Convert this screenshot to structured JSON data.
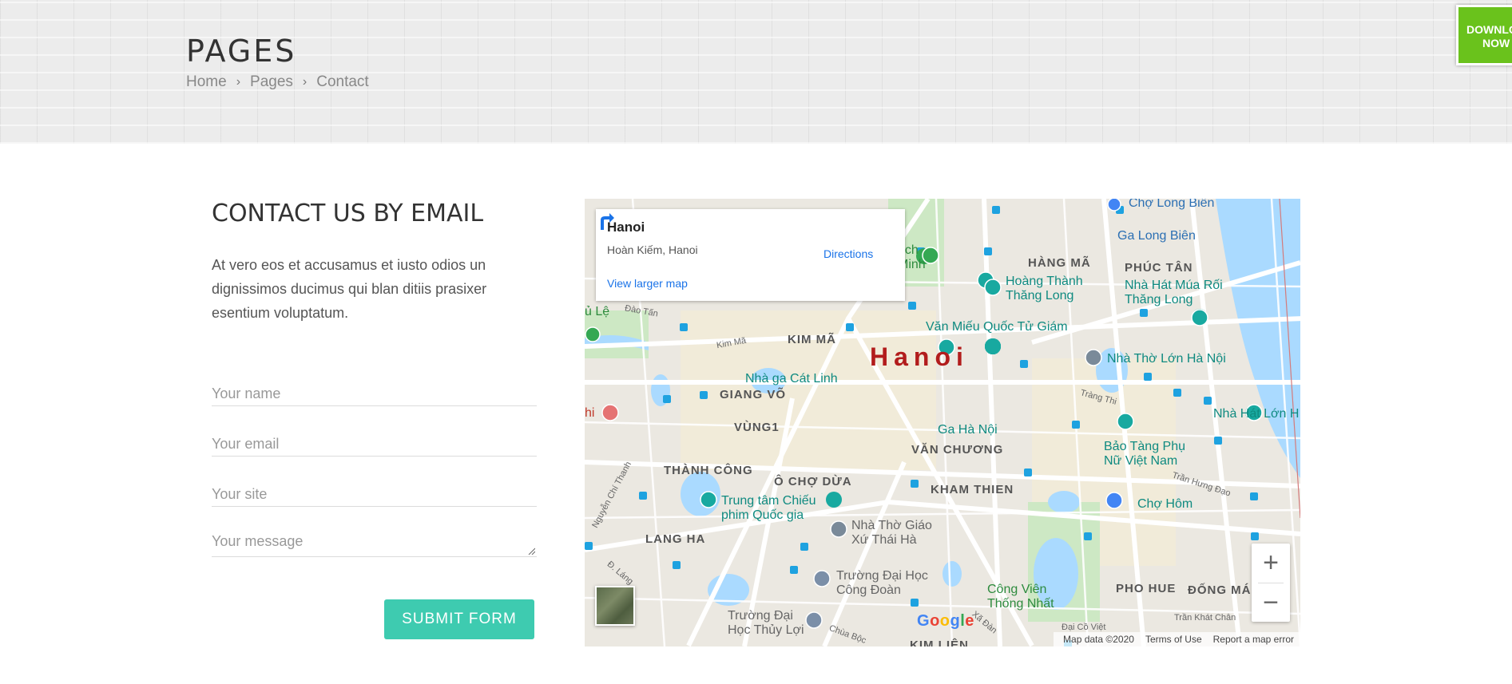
{
  "banner": {
    "title": "PAGES",
    "breadcrumb": [
      "Home",
      "Pages",
      "Contact"
    ]
  },
  "download": {
    "label_line1": "DOWNLOAD",
    "label_line2": "NOW",
    "color": "#6ac21c"
  },
  "contact": {
    "title": "CONTACT US BY EMAIL",
    "description": "At vero eos et accusamus et iusto odios un dignissimos ducimus qui blan ditiis prasixer esentium voluptatum.",
    "fields": {
      "name_placeholder": "Your name",
      "email_placeholder": "Your email",
      "site_placeholder": "Your site",
      "message_placeholder": "Your message"
    },
    "submit_label": "SUBMIT FORM",
    "accent_color": "#3ecbb0"
  },
  "map": {
    "info": {
      "city": "Hanoi",
      "address": "Hoàn Kiếm, Hanoi",
      "larger_map": "View larger map",
      "directions": "Directions"
    },
    "city_label": "Hanoi",
    "districts": [
      "HÀNG MÃ",
      "PHÚC TÂN",
      "KIM MÃ",
      "GIANG VÕ",
      "VÙNG1",
      "VĂN CHƯƠNG",
      "THÀNH CÔNG",
      "Ô CHỢ DỪA",
      "KHAM THIEN",
      "LANG HA",
      "PHO HUE",
      "ĐỐNG MÁ",
      "KIM LIÊN"
    ],
    "pois": [
      "Chợ Long Biên",
      "Ga Long Biên",
      "Hoàng Thành Thăng Long",
      "Nhà Hát Múa Rối Thăng Long",
      "Văn Miếu Quốc Tử Giám",
      "Nhà Thờ Lớn Hà Nội",
      "Nhà ga Cát Linh",
      "Ga Hà Nội",
      "Nhà Hát Lớn H",
      "Bảo Tàng Phụ Nữ Việt Nam",
      "Chợ Hôm",
      "Trung tâm Chiếu phim Quốc gia",
      "Nhà Thờ Giáo Xứ Thái Hà",
      "Trường Đại Học Công Đoàn",
      "Công Viên Thống Nhất",
      "Trường Đại Học Thủy Lợi",
      "ủ Lệ",
      "hi",
      "tích Minh"
    ],
    "streets": [
      "Đào Tấn",
      "Kim Mã",
      "Tràng Thi",
      "Trần Hưng Đạo",
      "Nguyễn Chí Thanh",
      "Đ. Láng",
      "Chùa Bộc",
      "Xã Đàn",
      "Trần Khát Chân",
      "Đại Cồ Việt"
    ],
    "attribution": [
      "Map data ©2020",
      "Terms of Use",
      "Report a map error"
    ],
    "google": "Google",
    "zoom_in": "+",
    "zoom_out": "−"
  }
}
